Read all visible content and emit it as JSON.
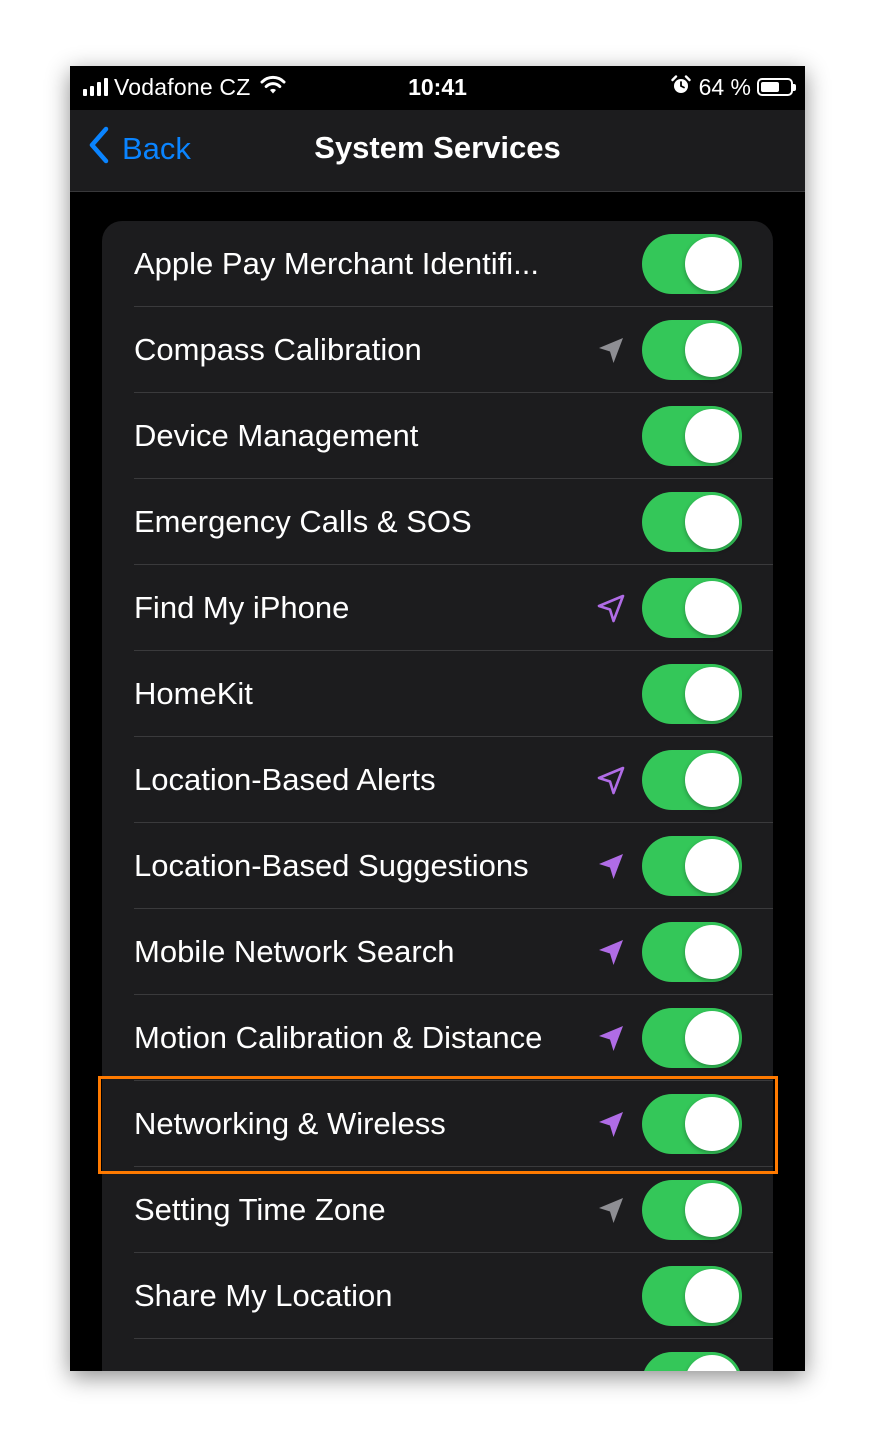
{
  "status_bar": {
    "carrier": "Vodafone CZ",
    "time": "10:41",
    "battery_percent": "64 %",
    "battery_level": 0.64,
    "alarm_icon": "alarm-clock-icon",
    "wifi_icon": "wifi-icon",
    "signal_icon": "cellular-signal-icon"
  },
  "nav": {
    "back_label": "Back",
    "back_icon": "chevron-left-icon",
    "title": "System Services"
  },
  "colors": {
    "toggle_on": "#34c759",
    "back_blue": "#0a84ff",
    "location_purple": "#b06ce6",
    "location_gray": "#8e8e93",
    "highlight": "#ff7a00"
  },
  "items": [
    {
      "label": "Apple Pay Merchant Identifi...",
      "location_indicator": "none",
      "on": true
    },
    {
      "label": "Compass Calibration",
      "location_indicator": "gray-filled",
      "on": true
    },
    {
      "label": "Device Management",
      "location_indicator": "none",
      "on": true
    },
    {
      "label": "Emergency Calls & SOS",
      "location_indicator": "none",
      "on": true
    },
    {
      "label": "Find My iPhone",
      "location_indicator": "purple-outline",
      "on": true
    },
    {
      "label": "HomeKit",
      "location_indicator": "none",
      "on": true
    },
    {
      "label": "Location-Based Alerts",
      "location_indicator": "purple-outline",
      "on": true
    },
    {
      "label": "Location-Based Suggestions",
      "location_indicator": "purple-filled",
      "on": true
    },
    {
      "label": "Mobile Network Search",
      "location_indicator": "purple-filled",
      "on": true
    },
    {
      "label": "Motion Calibration & Distance",
      "location_indicator": "purple-filled",
      "on": true
    },
    {
      "label": "Networking & Wireless",
      "location_indicator": "purple-filled",
      "on": true,
      "highlighted": true
    },
    {
      "label": "Setting Time Zone",
      "location_indicator": "gray-filled",
      "on": true
    },
    {
      "label": "Share My Location",
      "location_indicator": "none",
      "on": true
    },
    {
      "label": "",
      "location_indicator": "none",
      "on": true
    }
  ]
}
